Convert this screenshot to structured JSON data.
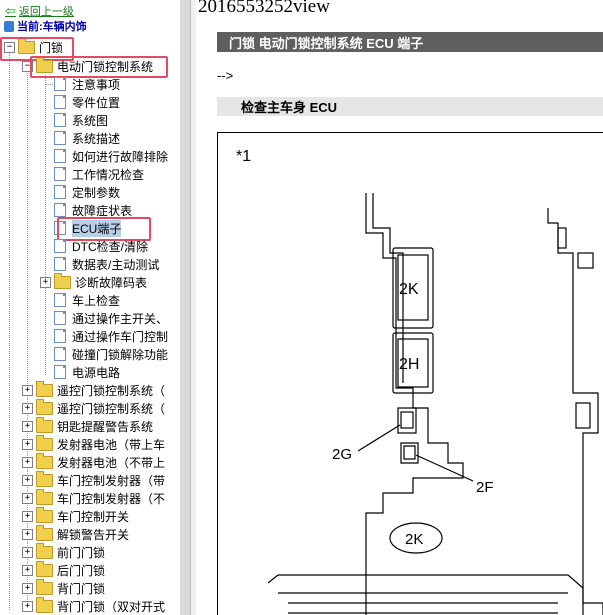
{
  "nav": {
    "back_label": "返回上一级",
    "current_label": "当前:车辆内饰"
  },
  "tree": {
    "root_label": "门锁",
    "group_label": "电动门锁控制系统",
    "items": [
      "注意事项",
      "零件位置",
      "系统图",
      "系统描述",
      "如何进行故障排除",
      "工作情况检查",
      "定制参数",
      "故障症状表",
      "ECU端子",
      "DTC检查/清除",
      "数据表/主动测试",
      "诊断故障码表",
      "车上检查",
      "通过操作主开关、",
      "通过操作车门控制",
      "碰撞门锁解除功能",
      "电源电路"
    ],
    "selected_item": "ECU端子",
    "siblings": [
      "遥控门锁控制系统（",
      "遥控门锁控制系统（",
      "钥匙提醒警告系统",
      "发射器电池（带上车",
      "发射器电池（不带上",
      "车门控制发射器（带",
      "车门控制发射器（不",
      "车门控制开关",
      "解锁警告开关",
      "前门门锁",
      "后门门锁",
      "背门门锁",
      "背门门锁（双对开式"
    ]
  },
  "content": {
    "doc_title": "2016553252view",
    "header_bar": "门锁  电动门锁控制系统  ECU 端子",
    "arrow_text": "-->",
    "section_title": "检查主车身 ECU",
    "figure": {
      "note_mark": "*1",
      "label_2K": "2K",
      "label_2H": "2H",
      "label_2G": "2G",
      "label_2F": "2F",
      "label_2K_circle": "2K"
    }
  },
  "colors": {
    "highlight_box": "#e24b62",
    "header_bar_bg": "#5f5f5f",
    "section_bar_bg": "#e6e6e6",
    "folder": "#f1cf4e",
    "back_link": "#1a7a1a",
    "current_label": "#0000aa"
  }
}
